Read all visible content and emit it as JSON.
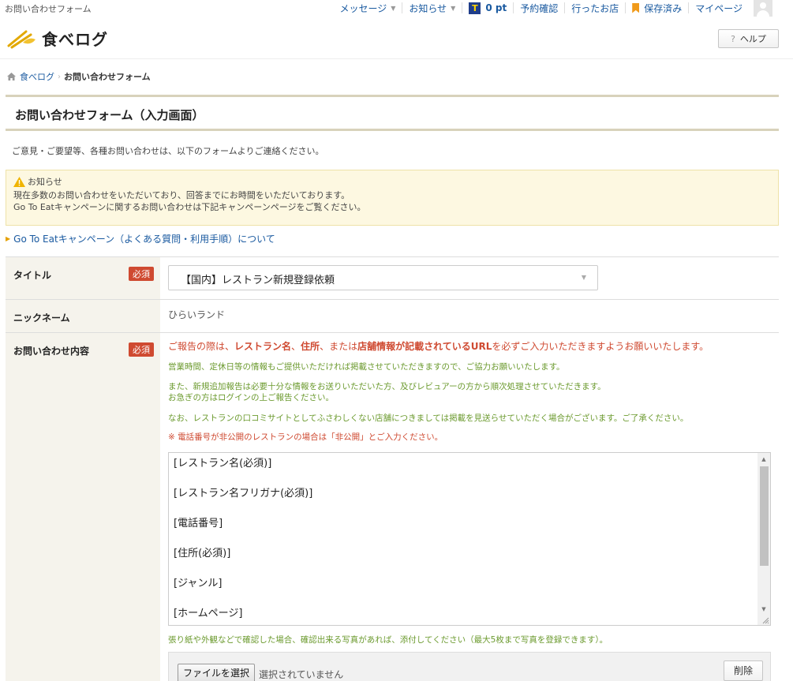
{
  "top_bar": {
    "site_label": "お問い合わせフォーム",
    "nav": {
      "messages": "メッセージ",
      "notices": "お知らせ",
      "points": "0 pt",
      "reservations": "予約確認",
      "visited": "行ったお店",
      "saved": "保存済み",
      "mypage": "マイページ"
    }
  },
  "header": {
    "logo": "食べログ",
    "help_label": "ヘルプ",
    "help_icon": "?"
  },
  "breadcrumb": {
    "home": "食べログ",
    "current": "お問い合わせフォーム"
  },
  "page_title": "お問い合わせフォーム（入力画面）",
  "intro": "ご意見・ご要望等、各種お問い合わせは、以下のフォームよりご連絡ください。",
  "notice": {
    "title": "お知らせ",
    "line1": "現在多数のお問い合わせをいただいており、回答までにお時間をいただいております。",
    "line2": "Go To Eatキャンペーンに関するお問い合わせは下記キャンペーンページをご覧ください。"
  },
  "campaign_link": "Go To Eatキャンペーン（よくある質問・利用手順）について",
  "form": {
    "required_badge": "必須",
    "title_label": "タイトル",
    "title_selected": "【国内】レストラン新規登録依頼",
    "nickname_label": "ニックネーム",
    "nickname_value": "ひらいランド",
    "inquiry_label": "お問い合わせ内容",
    "instructions": {
      "main_prefix": "ご報告の際は、",
      "main_bold1": "レストラン名",
      "main_sep1": "、",
      "main_bold2": "住所",
      "main_mid": "、または",
      "main_bold3": "店舗情報が記載されているURL",
      "main_suffix": "を必ずご入力いただきますようお願いいたします。",
      "green1": "営業時間、定休日等の情報もご提供いただければ掲載させていただきますので、ご協力お願いいたします。",
      "green2a": "また、新規追加報告は必要十分な情報をお送りいただいた方、及びレビュアーの方から順次処理させていただきます。",
      "green2b": "お急ぎの方はログインの上ご報告ください。",
      "green3": "なお、レストランの口コミサイトとしてふさわしくない店舗につきましては掲載を見送らせていただく場合がございます。ご了承ください。",
      "red_note": "※ 電話番号が非公開のレストランの場合は「非公開」とご入力ください。"
    },
    "textarea_lines": [
      "[レストラン名(必須)]",
      "[レストラン名フリガナ(必須)]",
      "[電話番号]",
      "[住所(必須)]",
      "[ジャンル]",
      "[ホームページ]"
    ],
    "photo_note": "張り紙や外観などで確認した場合、確認出来る写真があれば、添付してください（最大5枚まで写真を登録できます）。",
    "file_button": "ファイルを選択",
    "file_status": "選択されていません",
    "delete_button": "削除"
  },
  "colors": {
    "required": "#cf4a31",
    "green_text": "#6b9a2e",
    "link": "#1a5aa0",
    "title_rule": "#d8d2bb",
    "notice_bg": "#fdf8e1"
  }
}
